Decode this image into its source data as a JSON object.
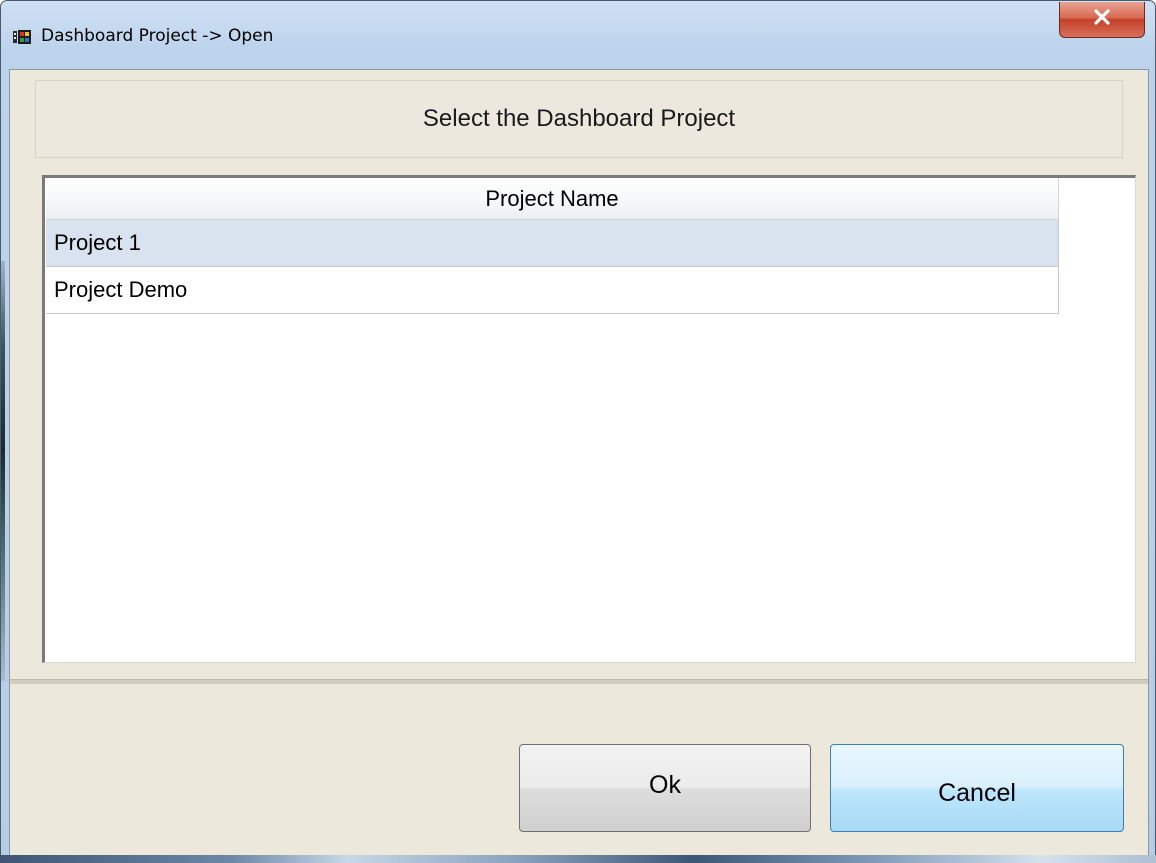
{
  "window": {
    "title": "Dashboard Project -> Open",
    "icon": "app-icon",
    "close_icon": "close-icon"
  },
  "header": {
    "text": "Select the Dashboard Project"
  },
  "table": {
    "column_header": "Project Name",
    "rows": [
      {
        "label": "Project 1",
        "selected": true
      },
      {
        "label": "Project Demo",
        "selected": false
      }
    ]
  },
  "buttons": {
    "ok_label": "Ok",
    "cancel_label": "Cancel"
  },
  "colors": {
    "selection": "#d9e3ef",
    "dialog_bg": "#ece9dc",
    "close_button": "#c4402a"
  }
}
